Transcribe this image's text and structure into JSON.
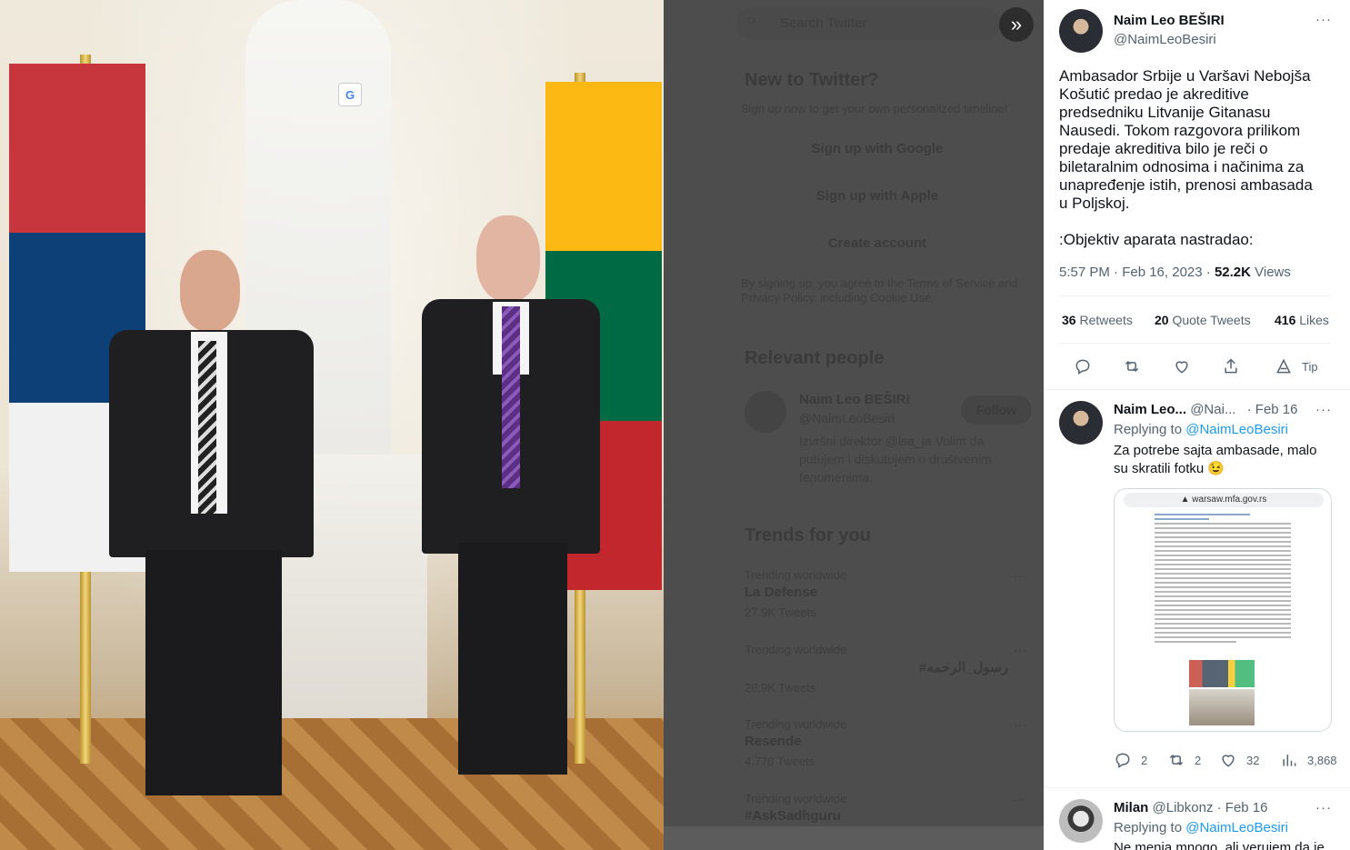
{
  "photo": {
    "translate_badge": "G"
  },
  "overlay": {
    "search_placeholder": "Search Twitter",
    "expand_icon": "»",
    "new_to_twitter": {
      "title": "New to Twitter?",
      "subtitle": "Sign up now to get your own personalized timeline!",
      "google_btn": "Sign up with Google",
      "apple_btn": "Sign up with Apple",
      "create_btn": "Create account",
      "legal_line1": "By signing up, you agree to the Terms of Service and",
      "legal_line2": "Privacy Policy, including Cookie Use."
    },
    "relevant_people": {
      "title": "Relevant people",
      "name": "Naim Leo BEŠIRI",
      "handle": "@NaimLeoBesiri",
      "follow": "Follow",
      "bio_line1": "Izvršni direktor @isa_ja Volim da",
      "bio_line2": "putujem i diskutujem o društvenim",
      "bio_line3": "fenomenima."
    },
    "trends": {
      "title": "Trends for you",
      "items": [
        {
          "meta": "Trending worldwide",
          "name": "La Defense",
          "count": "27.9K Tweets"
        },
        {
          "meta": "Trending worldwide",
          "name": "#رسول_الرحمه",
          "count": "26.9K Tweets"
        },
        {
          "meta": "Trending worldwide",
          "name": "Resende",
          "count": "4,770 Tweets"
        },
        {
          "meta": "Trending worldwide",
          "name": "#AskSadhguru",
          "count": ""
        }
      ]
    }
  },
  "tweet": {
    "author_name": "Naim Leo BEŠIRI",
    "author_handle": "@NaimLeoBesiri",
    "text_lines": [
      "Ambasador Srbije u Varšavi Nebojša",
      "Košutić predao je akreditive",
      "predsedniku Litvanije Gitanasu",
      "Nausedi. Tokom razgovora prilikom",
      "predaje akreditiva bilo je reči o",
      "biletaralnim odnosima i načinima za",
      "unapređenje istih, prenosi ambasada",
      "u Poljskoj."
    ],
    "text_extra": ":Objektiv aparata nastradao:",
    "time": "5:57 PM · Feb 16, 2023 ·",
    "views_count": "52.2K",
    "views_label": "Views",
    "retweets_count": "36",
    "retweets_label": "Retweets",
    "quotes_count": "20",
    "quotes_label": "Quote Tweets",
    "likes_count": "416",
    "likes_label": "Likes",
    "tip_label": "Tip"
  },
  "reply1": {
    "name": "Naim Leo...",
    "handle": "@Nai...",
    "date": "· Feb 16",
    "replying_prefix": "Replying to",
    "replying_to": "@NaimLeoBesiri",
    "text_line1": "Za potrebe sajta ambasade, malo",
    "text_line2": "su skratili fotku 😉",
    "embed_url": "▲ warsaw.mfa.gov.rs",
    "replies": "2",
    "retweets": "2",
    "likes": "32",
    "views": "3,868"
  },
  "reply2": {
    "name": "Milan",
    "handle": "@Libkonz",
    "date": "· Feb 16",
    "replying_prefix": "Replying to",
    "replying_to": "@NaimLeoBesiri",
    "text_line1": "Ne menja mnogo, ali verujem da je"
  },
  "colors": {
    "accent": "#1d9bf0",
    "text": "#0f1419",
    "muted": "#536471"
  }
}
